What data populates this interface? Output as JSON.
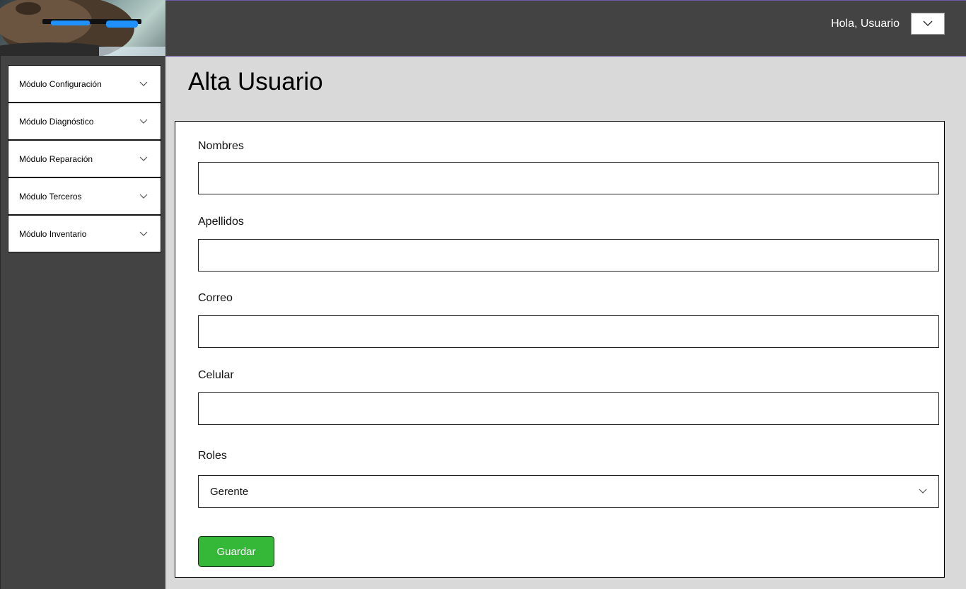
{
  "header": {
    "greeting": "Hola, Usuario",
    "user_menu_icon": "chevron-down-icon"
  },
  "sidebar": {
    "items": [
      {
        "label": "Módulo Configuración",
        "icon": "chevron-down-icon"
      },
      {
        "label": "Módulo Diagnóstico",
        "icon": "chevron-down-icon"
      },
      {
        "label": "Módulo Reparación",
        "icon": "chevron-down-icon"
      },
      {
        "label": "Módulo Terceros",
        "icon": "chevron-down-icon"
      },
      {
        "label": "Módulo Inventario",
        "icon": "chevron-down-icon"
      }
    ]
  },
  "main": {
    "title": "Alta Usuario",
    "form": {
      "nombres": {
        "label": "Nombres",
        "value": ""
      },
      "apellidos": {
        "label": "Apellidos",
        "value": ""
      },
      "correo": {
        "label": "Correo",
        "value": ""
      },
      "celular": {
        "label": "Celular",
        "value": ""
      },
      "roles": {
        "label": "Roles",
        "selected": "Gerente"
      },
      "save_label": "Guardar"
    }
  },
  "colors": {
    "topbar": "#434343",
    "sidebar": "#434343",
    "background": "#d9d9d9",
    "save_button": "#35b737",
    "accent_border": "#6e5aa8"
  }
}
